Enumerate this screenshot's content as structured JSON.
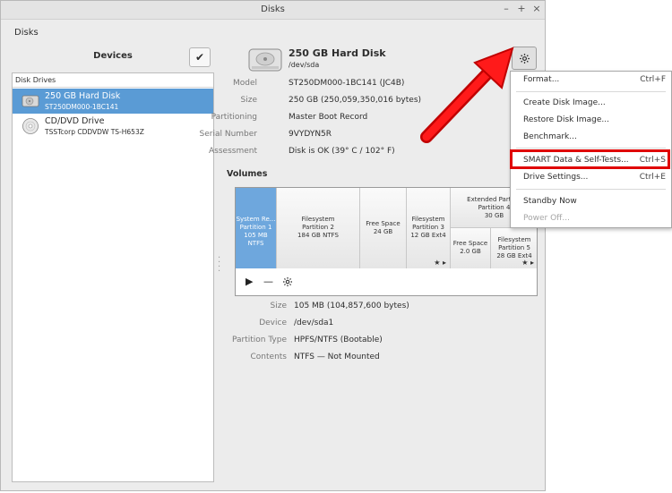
{
  "window": {
    "title": "Disks",
    "app_menu": "Disks"
  },
  "sidebar": {
    "title": "Devices",
    "section": "Disk Drives",
    "items": [
      {
        "name": "250 GB Hard Disk",
        "model": "ST250DM000-1BC141"
      },
      {
        "name": "CD/DVD Drive",
        "model": "TSSTcorp CDDVDW TS-H653Z"
      }
    ]
  },
  "disk": {
    "title": "250 GB Hard Disk",
    "device": "/dev/sda",
    "props": [
      {
        "label": "Model",
        "value": "ST250DM000-1BC141 (JC4B)"
      },
      {
        "label": "Size",
        "value": "250 GB (250,059,350,016 bytes)"
      },
      {
        "label": "Partitioning",
        "value": "Master Boot Record"
      },
      {
        "label": "Serial Number",
        "value": "9VYDYN5R"
      },
      {
        "label": "Assessment",
        "value": "Disk is OK (39° C / 102° F)"
      }
    ]
  },
  "volumes": {
    "title": "Volumes",
    "cells": [
      [
        "System Re...",
        "Partition 1",
        "105 MB NTFS"
      ],
      [
        "Filesystem",
        "Partition 2",
        "184 GB NTFS"
      ],
      [
        "Free Space",
        "24 GB"
      ],
      [
        "Filesystem",
        "Partition 3",
        "12 GB Ext4"
      ],
      [
        "Extended Partit...",
        "Partition 4",
        "30 GB"
      ],
      [
        "Free Space",
        "2.0 GB"
      ],
      [
        "Filesystem",
        "Partition 5",
        "28 GB Ext4"
      ]
    ],
    "props": [
      {
        "label": "Size",
        "value": "105 MB (104,857,600 bytes)"
      },
      {
        "label": "Device",
        "value": "/dev/sda1"
      },
      {
        "label": "Partition Type",
        "value": "HPFS/NTFS (Bootable)"
      },
      {
        "label": "Contents",
        "value": "NTFS — Not Mounted"
      }
    ]
  },
  "menu": {
    "items": [
      {
        "label": "Format...",
        "shortcut": "Ctrl+F"
      },
      {
        "label": "Create Disk Image...",
        "shortcut": ""
      },
      {
        "label": "Restore Disk Image...",
        "shortcut": ""
      },
      {
        "label": "Benchmark...",
        "shortcut": ""
      },
      {
        "label": "SMART Data & Self-Tests...",
        "shortcut": "Ctrl+S"
      },
      {
        "label": "Drive Settings...",
        "shortcut": "Ctrl+E"
      },
      {
        "label": "Standby Now",
        "shortcut": ""
      },
      {
        "label": "Power Off...",
        "shortcut": ""
      }
    ]
  },
  "colors": {
    "selection": "#5a9bd5",
    "highlight": "#e00000"
  },
  "icons": [
    "minimize-icon",
    "maximize-icon",
    "close-icon",
    "checkmark-icon",
    "hard-disk-icon",
    "optical-disc-icon",
    "gear-icon",
    "play-icon",
    "minus-icon",
    "settings-icon",
    "star-icon",
    "arrow-icon"
  ]
}
